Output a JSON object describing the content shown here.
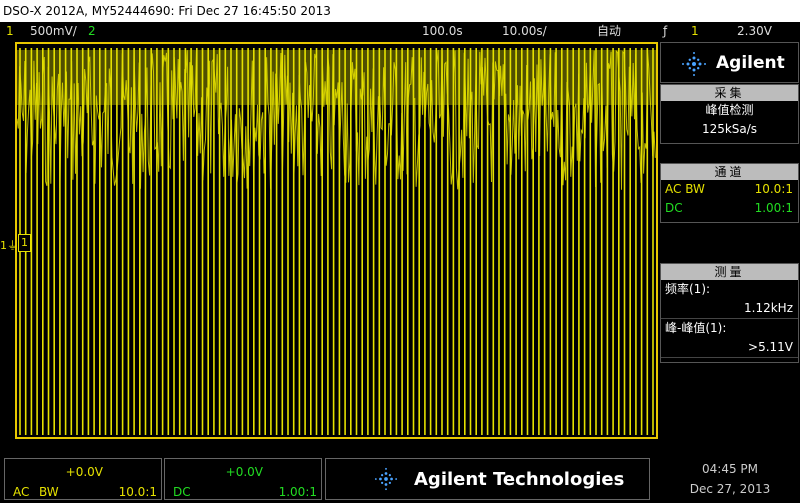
{
  "title": "DSO-X 2012A, MY52444690: Fri Dec 27 16:45:50 2013",
  "status": {
    "ch1_num": "1",
    "ch1_scale": "500mV/",
    "ch2_num": "2",
    "time_ref": "100.0s",
    "time_scale": "10.00s/",
    "trigger_mode": "自动",
    "trigger_symbol": "ƒ",
    "trigger_source": "1",
    "trigger_level": "2.30V"
  },
  "screen": {
    "ground_symbol": "1⏚",
    "channel_badge": "1"
  },
  "sidebar": {
    "logo": "Agilent",
    "acquire": {
      "header": "采集",
      "mode": "峰值检测",
      "rate": "125kSa/s"
    },
    "channel": {
      "header": "通道",
      "row1_label": "AC BW",
      "row1_value": "10.0:1",
      "row2_label": "DC",
      "row2_value": "1.00:1"
    },
    "measure": {
      "header": "测量",
      "m1_label": "频率(1):",
      "m1_value": "1.12kHz",
      "m2_label": "峰-峰值(1):",
      "m2_value": ">5.11V"
    }
  },
  "bottom": {
    "ch1": {
      "offset": "+0.0V",
      "coupling": "AC",
      "bw": "BW",
      "probe": "10.0:1"
    },
    "ch2": {
      "offset": "+0.0V",
      "coupling": "DC",
      "probe": "1.00:1"
    },
    "brand": "Agilent Technologies",
    "time": "04:45 PM",
    "date": "Dec 27, 2013"
  },
  "colors": {
    "ch1": "#e5e100",
    "ch2": "#22dd22",
    "frame": "#e8c800",
    "trigger_marker": "#ff8c00",
    "logo_blue": "#4aa3ff"
  },
  "chart_data": {
    "type": "line",
    "series": [
      {
        "values": [],
        "color": "#e5e100"
      }
    ]
  }
}
